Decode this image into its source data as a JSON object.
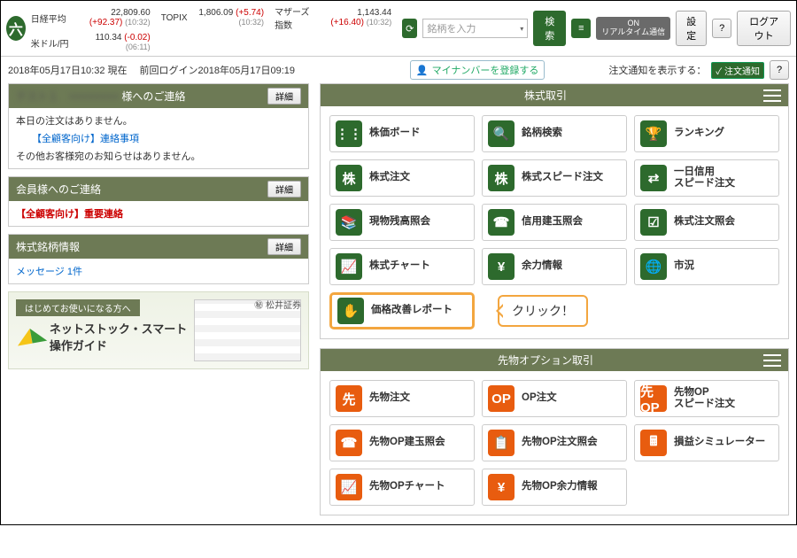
{
  "header": {
    "logo": "六",
    "tickers": [
      {
        "name": "日経平均",
        "value": "22,809.60",
        "delta": "(+92.37)",
        "time": "(10:32)"
      },
      {
        "name": "TOPIX",
        "value": "1,806.09",
        "delta": "(+5.74)",
        "time": "(10:32)"
      },
      {
        "name": "マザーズ指数",
        "value": "1,143.44",
        "delta": "(+16.40)",
        "time": "(10:32)"
      },
      {
        "name": "米ドル/円",
        "value": "110.34",
        "delta": "(-0.02)",
        "time": "(06:11)"
      }
    ],
    "search_placeholder": "銘柄を入力",
    "search_btn": "検索",
    "realtime": "ON\nリアルタイム通信",
    "settings": "設定",
    "logout": "ログアウト"
  },
  "row2": {
    "timestamp": "2018年05月17日10:32 現在",
    "last_login": "前回ログイン2018年05月17日09:19",
    "mynumber": "マイナンバーを登録する",
    "notice_label": "注文通知を表示する：",
    "notice_chk": "✓ 注文通知"
  },
  "left": {
    "p1_title": "様へのご連絡",
    "p1_blur": "テスト１　××××××××",
    "detail": "詳細",
    "p1_l1": "本日の注文はありません。",
    "p1_l2": "【全顧客向け】連絡事項",
    "p1_l3": "その他お客様宛のお知らせはありません。",
    "p2_title": "会員様へのご連絡",
    "p2_l1": "【全顧客向け】重要連絡",
    "p3_title": "株式銘柄情報",
    "p3_l1": "メッセージ 1件",
    "banner_hdr": "はじめてお使いになる方へ",
    "banner_big": "ネットストック・スマート\n操作ガイド",
    "banner_corp": "㊙ 松井証券"
  },
  "stock_panel": {
    "title": "株式取引",
    "items": [
      {
        "label": "株価ボード",
        "glyph": "⋮⋮"
      },
      {
        "label": "銘柄検索",
        "glyph": "🔍"
      },
      {
        "label": "ランキング",
        "glyph": "🏆"
      },
      {
        "label": "株式注文",
        "glyph": "株"
      },
      {
        "label": "株式スピード注文",
        "glyph": "株"
      },
      {
        "label": "一日信用\nスピード注文",
        "glyph": "⇄"
      },
      {
        "label": "現物残高照会",
        "glyph": "📚"
      },
      {
        "label": "信用建玉照会",
        "glyph": "☎"
      },
      {
        "label": "株式注文照会",
        "glyph": "☑"
      },
      {
        "label": "株式チャート",
        "glyph": "📈"
      },
      {
        "label": "余力情報",
        "glyph": "¥"
      },
      {
        "label": "市況",
        "glyph": "🌐"
      },
      {
        "label": "価格改善レポート",
        "glyph": "✋",
        "highlight": true
      }
    ],
    "callout": "クリック！"
  },
  "futures_panel": {
    "title": "先物オプション取引",
    "items": [
      {
        "label": "先物注文",
        "glyph": "先"
      },
      {
        "label": "OP注文",
        "glyph": "OP"
      },
      {
        "label": "先物OP\nスピード注文",
        "glyph": "先OP"
      },
      {
        "label": "先物OP建玉照会",
        "glyph": "☎"
      },
      {
        "label": "先物OP注文照会",
        "glyph": "📋"
      },
      {
        "label": "損益シミュレーター",
        "glyph": "🖩"
      },
      {
        "label": "先物OPチャート",
        "glyph": "📈"
      },
      {
        "label": "先物OP余力情報",
        "glyph": "¥"
      }
    ]
  }
}
